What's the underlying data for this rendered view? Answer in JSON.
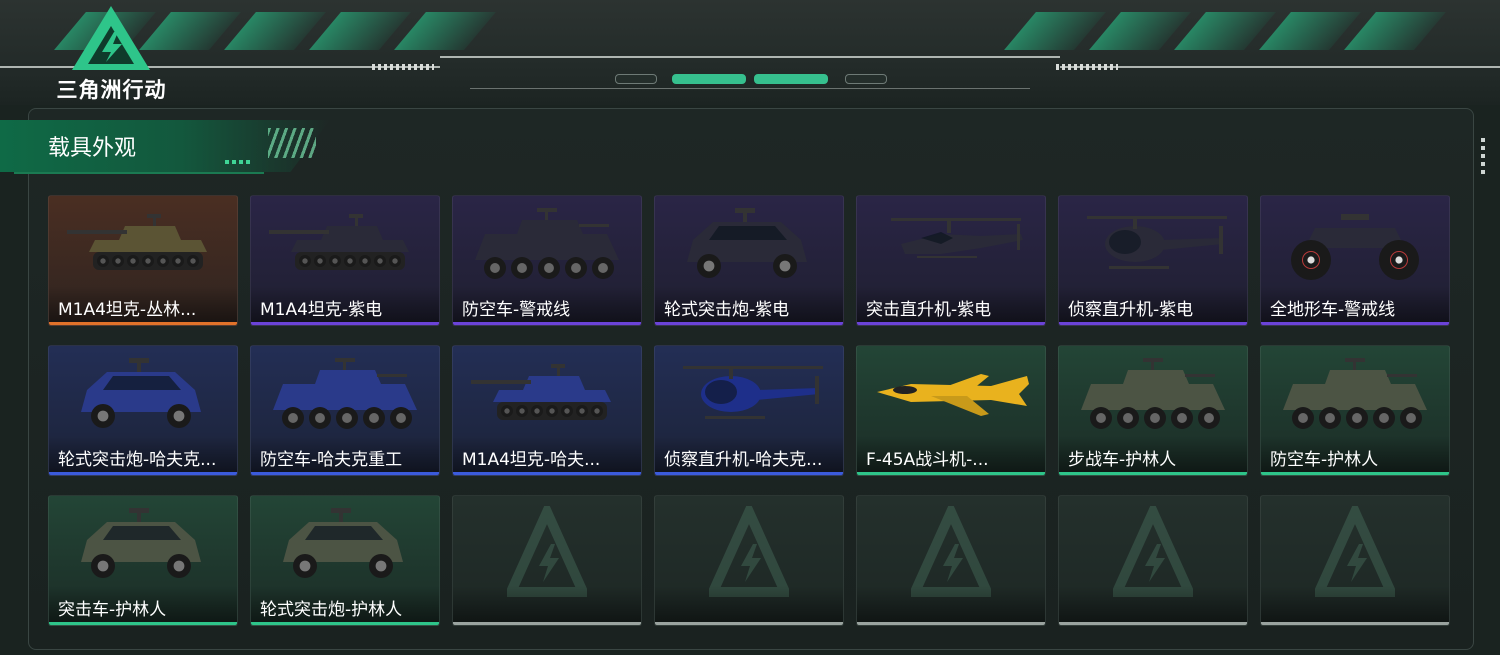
{
  "app": {
    "logo_text": "三角洲行动"
  },
  "section": {
    "title": "载具外观"
  },
  "colors": {
    "accent": "#2ec58a",
    "orange": "#e0722a",
    "purple": "#6b43d8",
    "blue": "#3b5bdc",
    "empty": "#9aa39f"
  },
  "cards": [
    {
      "label": "M1A4坦克-丛林...",
      "rarity": "orange",
      "icon": "tank-icon"
    },
    {
      "label": "M1A4坦克-紫电",
      "rarity": "purple",
      "icon": "tank-icon"
    },
    {
      "label": "防空车-警戒线",
      "rarity": "purple",
      "icon": "aa-vehicle-icon"
    },
    {
      "label": "轮式突击炮-紫电",
      "rarity": "purple",
      "icon": "armored-car-icon"
    },
    {
      "label": "突击直升机-紫电",
      "rarity": "purple",
      "icon": "attack-helicopter-icon"
    },
    {
      "label": "侦察直升机-紫电",
      "rarity": "purple",
      "icon": "scout-helicopter-icon"
    },
    {
      "label": "全地形车-警戒线",
      "rarity": "purple",
      "icon": "atv-icon"
    },
    {
      "label": "轮式突击炮-哈夫克...",
      "rarity": "blue",
      "icon": "armored-car-icon"
    },
    {
      "label": "防空车-哈夫克重工",
      "rarity": "blue",
      "icon": "aa-vehicle-icon"
    },
    {
      "label": "M1A4坦克-哈夫...",
      "rarity": "blue",
      "icon": "tank-icon"
    },
    {
      "label": "侦察直升机-哈夫克...",
      "rarity": "blue",
      "icon": "scout-helicopter-icon"
    },
    {
      "label": "F-45A战斗机-...",
      "rarity": "green",
      "icon": "fighter-jet-icon"
    },
    {
      "label": "步战车-护林人",
      "rarity": "green",
      "icon": "ifv-icon"
    },
    {
      "label": "防空车-护林人",
      "rarity": "green",
      "icon": "aa-vehicle-icon"
    },
    {
      "label": "突击车-护林人",
      "rarity": "green",
      "icon": "assault-car-icon"
    },
    {
      "label": "轮式突击炮-护林人",
      "rarity": "green",
      "icon": "armored-car-icon"
    },
    {
      "label": "",
      "rarity": "empty",
      "icon": "delta-watermark-icon"
    },
    {
      "label": "",
      "rarity": "empty",
      "icon": "delta-watermark-icon"
    },
    {
      "label": "",
      "rarity": "empty",
      "icon": "delta-watermark-icon"
    },
    {
      "label": "",
      "rarity": "empty",
      "icon": "delta-watermark-icon"
    },
    {
      "label": "",
      "rarity": "empty",
      "icon": "delta-watermark-icon"
    }
  ]
}
